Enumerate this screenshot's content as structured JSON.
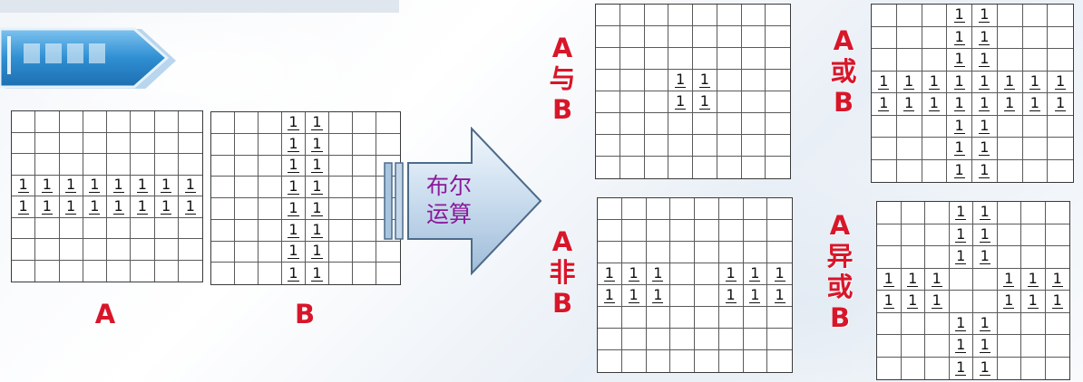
{
  "banner": {
    "accent": "#2a86c8",
    "icon": "document-icon"
  },
  "labels": {
    "A": "A",
    "B": "B",
    "and_a": "A",
    "and_op": "与",
    "and_b": "B",
    "or_a": "A",
    "or_op": "或",
    "or_b": "B",
    "not_a": "A",
    "not_op": "非",
    "not_b": "B",
    "xor_a": "A",
    "xor_op1": "异",
    "xor_op2": "或",
    "xor_b": "B"
  },
  "arrow": {
    "line1": "布尔",
    "line2": "运算"
  },
  "grids": {
    "A": [
      "",
      "",
      "",
      "11111111",
      "11111111",
      "",
      "",
      ""
    ],
    "B": [
      "...11...",
      "...11...",
      "...11...",
      "...11...",
      "...11...",
      "...11...",
      "...11...",
      "...11..."
    ],
    "AND": [
      "",
      "",
      "",
      "...11...",
      "...11...",
      "",
      "",
      ""
    ],
    "OR": [
      "...11...",
      "...11...",
      "...11...",
      "11111111",
      "11111111",
      "...11...",
      "...11...",
      "...11..."
    ],
    "NOT": [
      "",
      "",
      "",
      "111..111",
      "111..111",
      "",
      "",
      ""
    ],
    "XOR": [
      "...11...",
      "...11...",
      "...11...",
      "111..111",
      "111..111",
      "...11...",
      "...11...",
      "...11..."
    ]
  },
  "colors": {
    "label": "#d8162a",
    "arrow_text": "#8b1a9a",
    "arrow_fill": "#cfe0ef"
  }
}
